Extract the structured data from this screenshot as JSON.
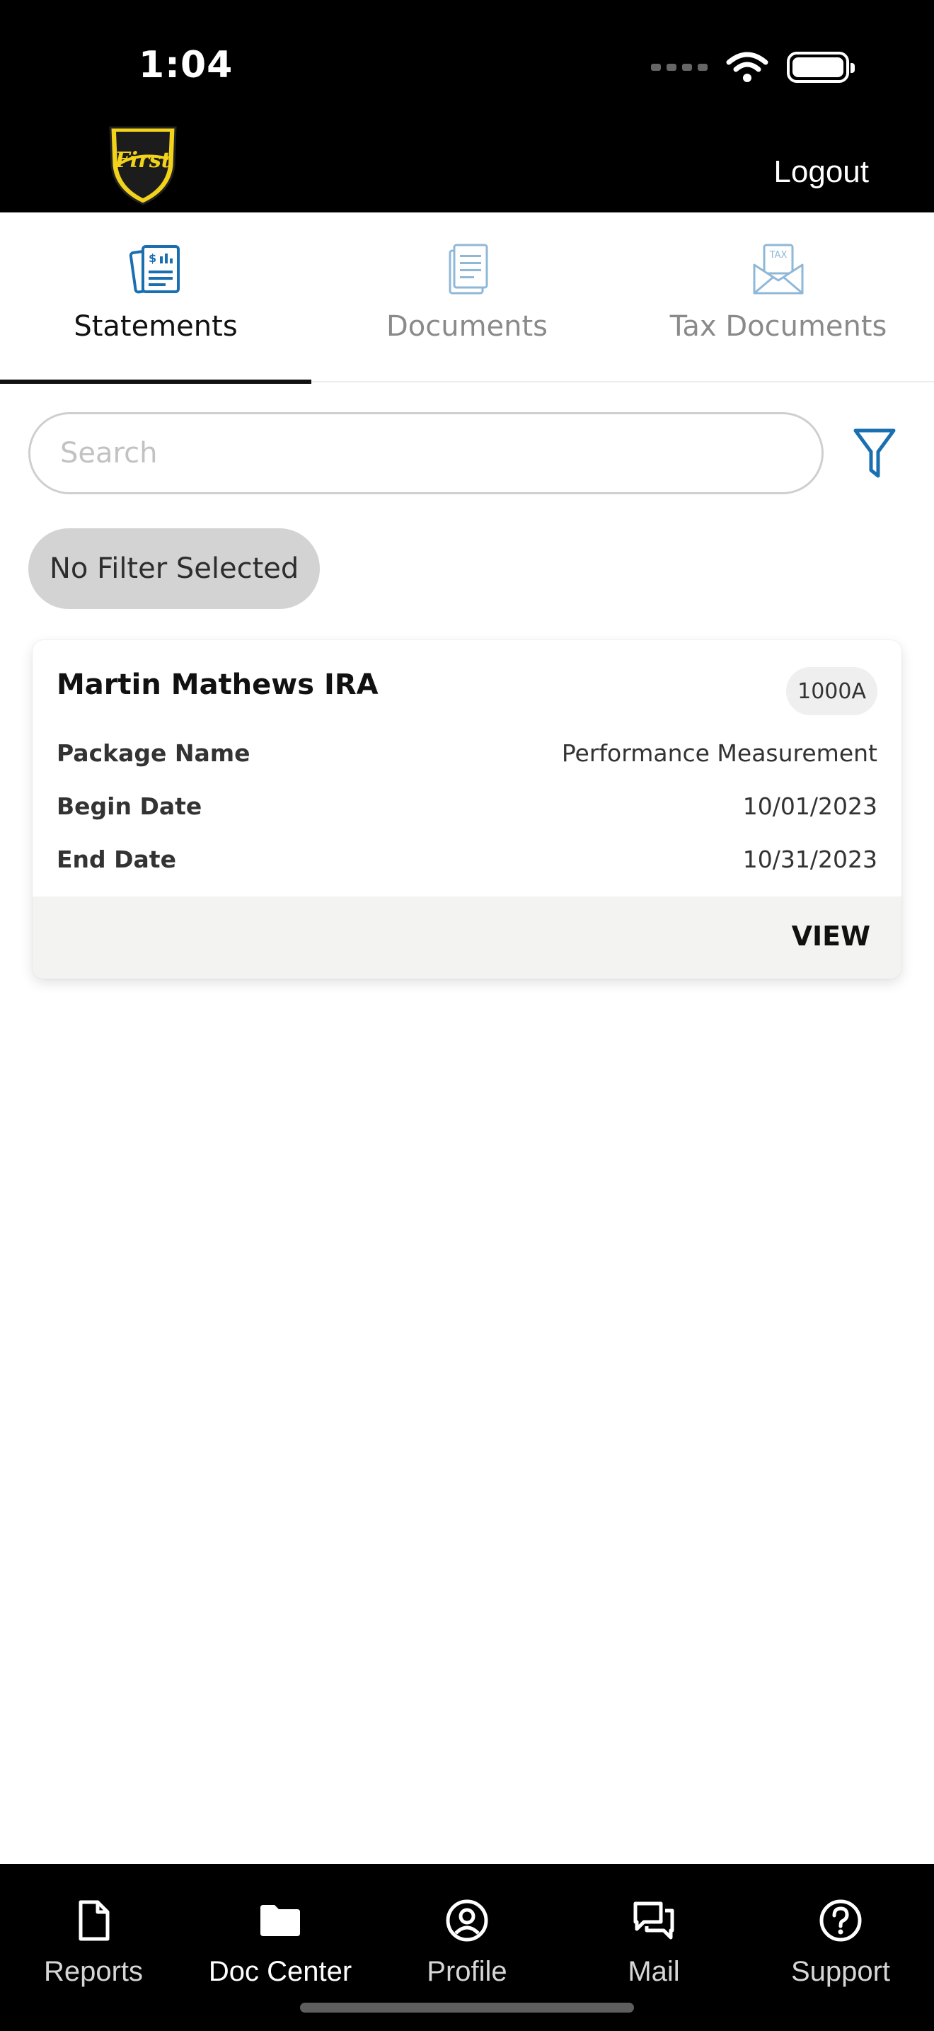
{
  "status_bar": {
    "time": "1:04"
  },
  "header": {
    "logo_text": "First",
    "logout_label": "Logout"
  },
  "tabs": [
    {
      "label": "Statements",
      "icon": "statement-icon",
      "active": true
    },
    {
      "label": "Documents",
      "icon": "document-icon",
      "active": false
    },
    {
      "label": "Tax Documents",
      "icon": "tax-document-icon",
      "active": false
    }
  ],
  "search": {
    "placeholder": "Search",
    "value": ""
  },
  "filter_chip": {
    "label": "No Filter Selected"
  },
  "card": {
    "title": "Martin Mathews IRA",
    "account_badge": "1000A",
    "fields": [
      {
        "label": "Package Name",
        "value": "Performance Measurement"
      },
      {
        "label": "Begin Date",
        "value": "10/01/2023"
      },
      {
        "label": "End Date",
        "value": "10/31/2023"
      }
    ],
    "action_label": "VIEW"
  },
  "bottom_nav": [
    {
      "label": "Reports",
      "icon": "file-icon",
      "active": false
    },
    {
      "label": "Doc Center",
      "icon": "folder-icon",
      "active": true
    },
    {
      "label": "Profile",
      "icon": "profile-icon",
      "active": false
    },
    {
      "label": "Mail",
      "icon": "chat-icon",
      "active": false
    },
    {
      "label": "Support",
      "icon": "help-icon",
      "active": false
    }
  ],
  "colors": {
    "accent": "#1a6fb0",
    "header_bg": "#000000",
    "logo_gold": "#f2d21a"
  }
}
